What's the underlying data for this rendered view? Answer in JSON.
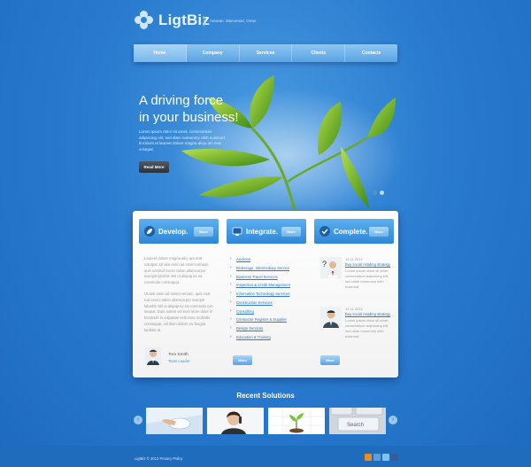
{
  "brand": {
    "name": "LigtBiz",
    "tagline": "Aenean. Maecenas. Onse."
  },
  "nav": {
    "items": [
      "Home",
      "Company",
      "Services",
      "Clients",
      "Contacts"
    ],
    "active": "Home"
  },
  "hero": {
    "title_line1": "A driving force",
    "title_line2": "in your business!",
    "text": "Lorem ipsum dolor sit amet, consectetuer adipiscing elit, sed diam nonummy nibh euismod tincidunt ut laoreet dolore magna aliqu am erat volutpat.",
    "button": "Read More"
  },
  "columns": {
    "develop": {
      "title": "Develop.",
      "more": "More"
    },
    "integrate": {
      "title": "Integrate.",
      "more": "More"
    },
    "complete": {
      "title": "Complete.",
      "more": "More"
    }
  },
  "develop": {
    "para1": "Laoreet dolore magna aliq. am erat volutpat. Ut wisi enim ad minim veniam, quis nostrud exerci tation ullamcorper suscipit lobortis nisl ut aliquip ex ea commodo consequat.",
    "para2": "Ut wisi enim ad minim veniam, quis nost rud exerci tation ullamcorper suscipit lobortis nisl ut aliquip ex ea commodo con sequat. Duis autem vel eum iriure dolor in hendrerit in vulputate velit esse molestie consequat, vel illum dolore eu feugiat facilisis at.",
    "person_name": "Tom Smith",
    "person_role": "Team Leader"
  },
  "integrate": {
    "links": [
      "Auctions",
      "Brokerage, Intermediary Service",
      "Business Travel Services",
      "Inspection & Credit Management",
      "Information Technology Services",
      "Construction Services",
      "Consulting",
      "Contractor Register & Supplier",
      "Design Services",
      "Education & Training"
    ],
    "more": "More"
  },
  "complete": {
    "news": [
      {
        "date": "12.11.2012",
        "title": "Buy social retailing strategy",
        "text": "Lorem ipsum dolor sit amet, consectetuer adipiscing elit, sed diam nonummy nibh euismod."
      },
      {
        "date": "12.11.2012",
        "title": "Buy social retailing strategy",
        "text": "Lorem ipsum dolor sit amet, consectetuer adipiscing elit, sed diam nonummy nibh euismod."
      }
    ],
    "more": "More"
  },
  "recent": {
    "title": "Recent Solutions",
    "thumb_text": "Search"
  },
  "footer": {
    "copyright": "LigtBiz © 2012 Privacy Policy"
  },
  "colors": {
    "accent": "#2f86d6",
    "background": "#2a7cd0",
    "link": "#2e7bc4"
  }
}
